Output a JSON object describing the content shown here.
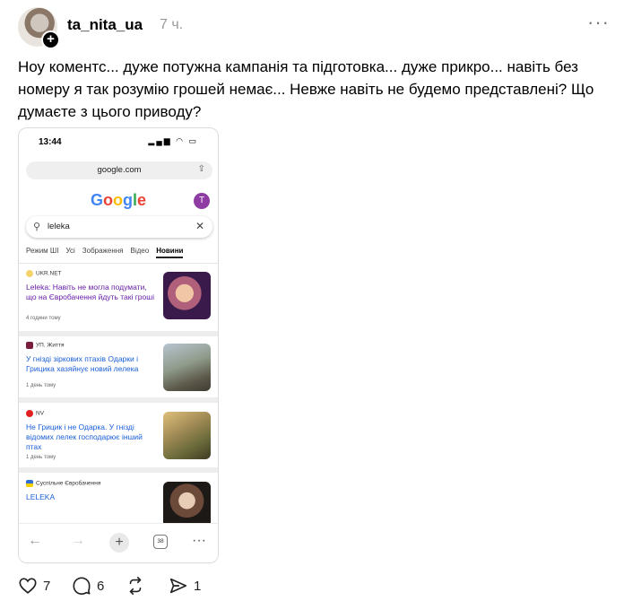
{
  "post": {
    "username": "ta_nita_ua",
    "time": "7 ч.",
    "text": "Ноу коментс... дуже потужна кампанія та підготовка... дуже прикро... навіть без номеру я так розумію грошей немає... Невже навіть не будемо представлені? Що думаєте з цього приводу?"
  },
  "phone": {
    "status_time": "13:44",
    "url": "google.com",
    "logo_letters": [
      "G",
      "o",
      "o",
      "g",
      "l",
      "e"
    ],
    "profile_initial": "T",
    "search_value": "leleka",
    "tabs": [
      {
        "label": "Режим ШІ",
        "active": false
      },
      {
        "label": "Усі",
        "active": false
      },
      {
        "label": "Зображення",
        "active": false
      },
      {
        "label": "Відео",
        "active": false
      },
      {
        "label": "Новини",
        "active": true
      }
    ],
    "news": [
      {
        "source": "UKR.NET",
        "headline": "Leleka: Навіть не могла подумати, що на Євробачення йдуть такі гроші",
        "age": "4 години тому"
      },
      {
        "source": "УП. Життя",
        "headline": "У гнізді зіркових птахів Одарки і Грицика хазяйнує новий лелека",
        "age": "1 день тому"
      },
      {
        "source": "NV",
        "headline": "Не Грицик і не Одарка. У гнізді відомих лелек господарює інший птах",
        "age": "1 день тому"
      },
      {
        "source": "Суспільне Євробачення",
        "headline": "LELEKA",
        "age": ""
      }
    ],
    "tabs_count": "38"
  },
  "actions": {
    "likes": "7",
    "comments": "6",
    "reposts": "",
    "shares": "1"
  },
  "colors": {
    "google_blue": "#4285f4",
    "google_red": "#ea4335",
    "google_yellow": "#fbbc05",
    "google_green": "#34a853",
    "link_blue": "#1a5fd8",
    "visited_purple": "#681da8"
  }
}
